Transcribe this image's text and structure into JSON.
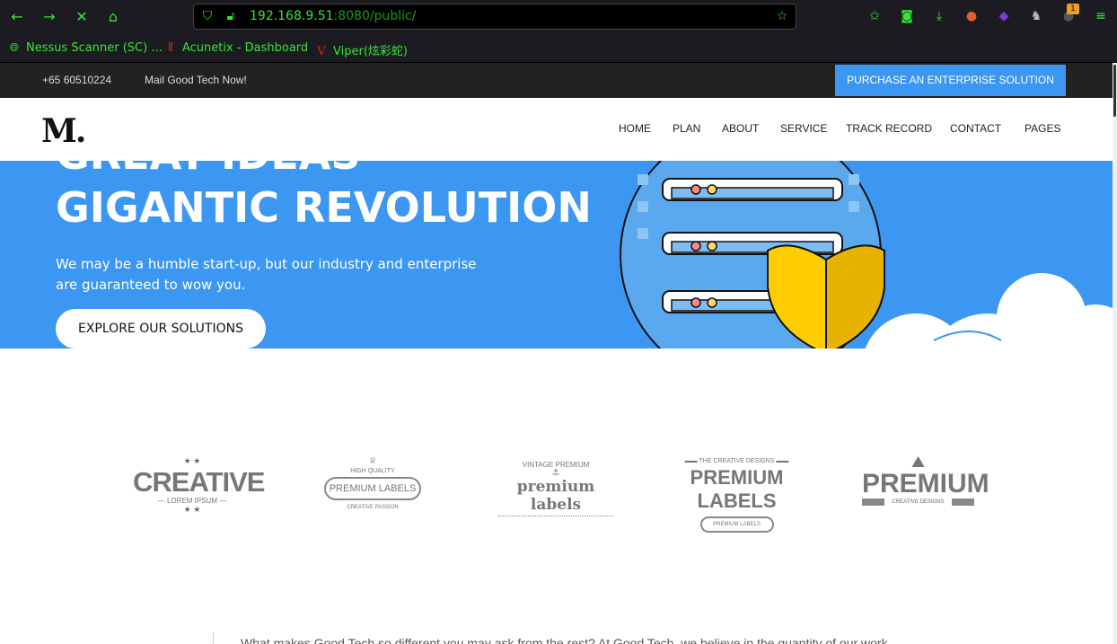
{
  "browser": {
    "url_host": "192.168.9.51",
    "url_path": ":8080/public/",
    "notification_count": "1"
  },
  "bookmarks": [
    {
      "label": "Nessus Scanner (SC) ...",
      "icon": "globe-icon"
    },
    {
      "label": "Acunetix - Dashboard",
      "icon": "acunetix-icon"
    },
    {
      "label": "Viper(炫彩蛇)",
      "icon": "viper-icon"
    }
  ],
  "topbar": {
    "phone": "+65 60510224",
    "mail": "Mail Good Tech Now!",
    "cta": "PURCHASE AN ENTERPRISE SOLUTION"
  },
  "nav": {
    "logo": "M.",
    "items": [
      "HOME",
      "PLAN",
      "ABOUT",
      "SERVICE",
      "TRACK RECORD",
      "CONTACT",
      "PAGES"
    ]
  },
  "hero": {
    "line1": "GREAT IDEAS",
    "line2": "GIGANTIC REVOLUTION",
    "subtitle": "We may be a humble start-up, but our industry and enterprise are guaranteed to wow you.",
    "button": "EXPLORE OUR SOLUTIONS"
  },
  "brands": {
    "b1_main": "CREATIVE",
    "b1_sub": "LOREM IPSUM",
    "b2_top": "HIGH QUALITY",
    "b2_main": "PREMIUM LABELS",
    "b2_sub": "CREATIVE PASSION",
    "b3_top": "VINTAGE PREMIUM",
    "b3_main": "premium labels",
    "b4_top": "THE CREATIVE DESIGNS",
    "b4_main": "PREMIUM LABELS",
    "b4_sub": "PREMIUM LABELS",
    "b5_main": "PREMIUM",
    "b5_sub": "CREATIVE DESIGNS"
  },
  "bottom": {
    "text": "What makes Good Tech so different you may ask from the rest? At Good Tech, we believe in the quantity of our work"
  },
  "colors": {
    "accent": "#3b97f2",
    "browser_green": "#35e635",
    "shield": "#ffcc00"
  }
}
